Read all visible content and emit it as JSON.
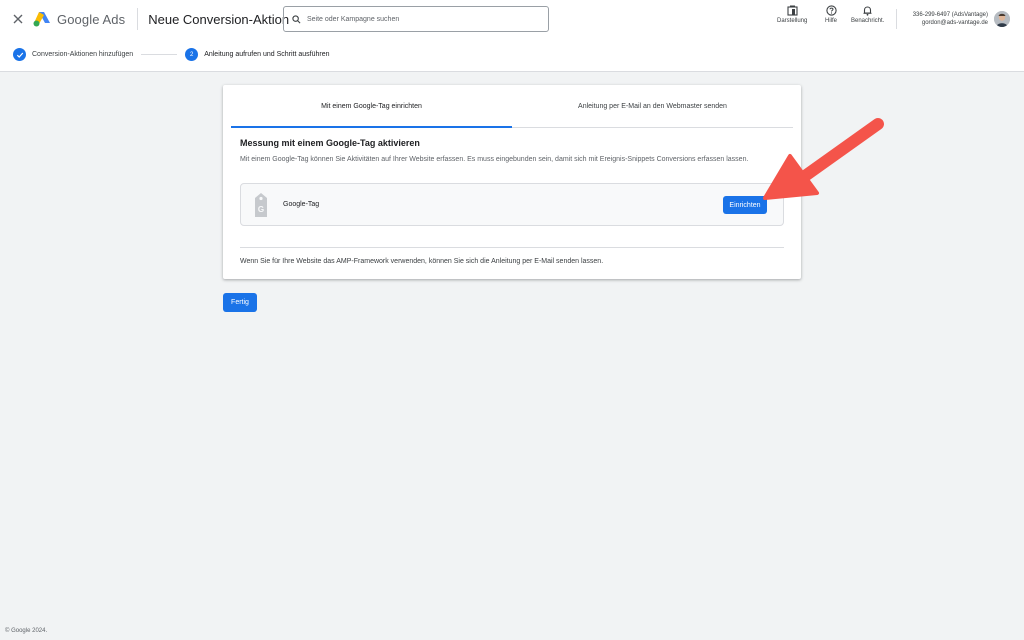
{
  "header": {
    "logo_text": "Google Ads",
    "page_title": "Neue Conversion-Aktion",
    "search_placeholder": "Seite oder Kampagne suchen",
    "tools": [
      {
        "label": "Darstellung",
        "icon": "appearance-icon"
      },
      {
        "label": "Hilfe",
        "icon": "help-icon"
      },
      {
        "label": "Benachricht.",
        "icon": "bell-icon"
      }
    ],
    "account_id": "336-299-6497 (AdsVantage)",
    "account_email": "gordon@ads-vantage.de"
  },
  "stepper": {
    "step1_label": "Conversion-Aktionen hinzufügen",
    "step2_number": "2",
    "step2_label": "Anleitung aufrufen und Schritt ausführen"
  },
  "card": {
    "tabs": [
      {
        "label": "Mit einem Google-Tag einrichten",
        "active": true
      },
      {
        "label": "Anleitung per E-Mail an den Webmaster senden",
        "active": false
      }
    ],
    "section_title": "Messung mit einem Google-Tag aktivieren",
    "section_desc": "Mit einem Google-Tag können Sie Aktivitäten auf Ihrer Website erfassen. Es muss eingebunden sein, damit sich mit Ereignis-Snippets Conversions erfassen lassen.",
    "tag_name": "Google-Tag",
    "setup_button": "Einrichten",
    "amp_note": "Wenn Sie für Ihre Website das AMP-Framework verwenden, können Sie sich die Anleitung per E-Mail senden lassen."
  },
  "done_button": "Fertig",
  "footer": "© Google 2024.",
  "colors": {
    "accent": "#1a73e8",
    "annotation_arrow": "#f4544a",
    "page_bg": "#f1f3f4"
  }
}
